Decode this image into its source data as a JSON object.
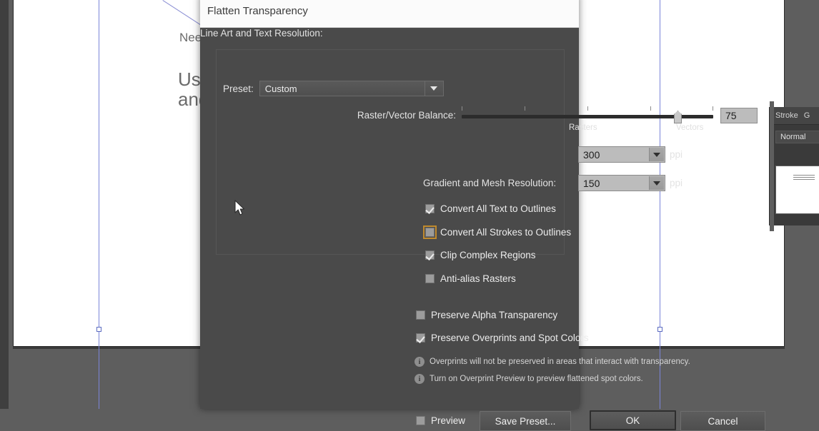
{
  "app": {
    "canvas_texts": [
      {
        "id": "need",
        "text": "Need"
      },
      {
        "id": "use",
        "text": "Use"
      },
      {
        "id": "and",
        "text": "and"
      }
    ]
  },
  "dock": {
    "tabs": [
      {
        "label": "Stroke"
      },
      {
        "label": "G"
      }
    ],
    "blend_mode": "Normal"
  },
  "dialog": {
    "title": "Flatten Transparency",
    "preset": {
      "label": "Preset:",
      "value": "Custom"
    },
    "balance": {
      "label": "Raster/Vector Balance:",
      "value": "75",
      "left_label": "Rasters",
      "right_label": "Vectors",
      "min": 0,
      "max": 100
    },
    "line_art": {
      "label": "Line Art and Text Resolution:",
      "value": "300",
      "unit": "ppi"
    },
    "gradient_mesh": {
      "label": "Gradient and Mesh Resolution:",
      "value": "150",
      "unit": "ppi"
    },
    "checkboxes": [
      {
        "id": "convert-all-text-to-outlines",
        "label": "Convert All Text to Outlines",
        "checked": true,
        "focused": false
      },
      {
        "id": "convert-all-strokes-to-outlines",
        "label": "Convert All Strokes to Outlines",
        "checked": false,
        "focused": true
      },
      {
        "id": "clip-complex-regions",
        "label": "Clip Complex Regions",
        "checked": true,
        "focused": false
      },
      {
        "id": "anti-alias-rasters",
        "label": "Anti-alias Rasters",
        "checked": false,
        "focused": false
      }
    ],
    "outer_checkboxes": [
      {
        "id": "preserve-alpha-transparency",
        "label": "Preserve Alpha Transparency",
        "checked": false
      },
      {
        "id": "preserve-overprints-and-spot-colors",
        "label": "Preserve Overprints and Spot Colors",
        "checked": true
      }
    ],
    "info_lines": [
      {
        "icon": "info-icon",
        "text": "Overprints will not be preserved in areas that interact with transparency."
      },
      {
        "icon": "info-icon",
        "text": "Turn on Overprint Preview to preview flattened spot colors."
      }
    ],
    "footer": {
      "preview_label": "Preview",
      "preview_checked": false,
      "save_preset_label": "Save Preset...",
      "ok_label": "OK",
      "cancel_label": "Cancel"
    }
  },
  "colors": {
    "dialog_bg": "#4a4a4a",
    "titlebar_bg": "#fbfbfb",
    "canvas_bg": "#5e5e5e",
    "focus_ring": "#c08a2e",
    "guide_blue": "#7b85d8",
    "field_bg": "#bcbcbc"
  }
}
